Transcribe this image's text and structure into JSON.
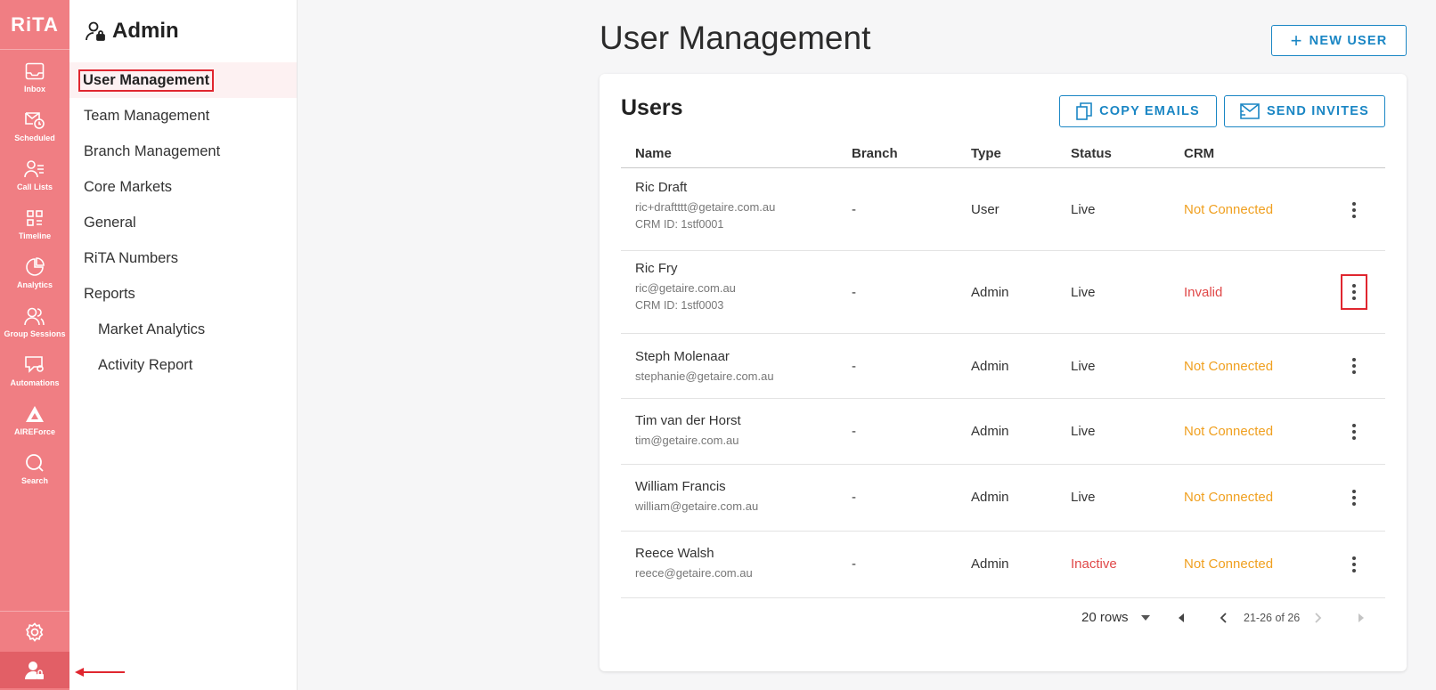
{
  "rail": {
    "logo": "RiTA",
    "items": [
      {
        "label": "Inbox",
        "icon": "inbox-icon"
      },
      {
        "label": "Scheduled",
        "icon": "scheduled-icon"
      },
      {
        "label": "Call Lists",
        "icon": "call-lists-icon"
      },
      {
        "label": "Timeline",
        "icon": "timeline-icon"
      },
      {
        "label": "Analytics",
        "icon": "analytics-icon"
      },
      {
        "label": "Group Sessions",
        "icon": "group-sessions-icon"
      },
      {
        "label": "Automations",
        "icon": "automations-icon"
      },
      {
        "label": "AIREForce",
        "icon": "aireforce-icon"
      },
      {
        "label": "Search",
        "icon": "search-icon"
      }
    ]
  },
  "sidebar": {
    "title": "Admin",
    "items": [
      {
        "label": "User Management",
        "active": true
      },
      {
        "label": "Team Management"
      },
      {
        "label": "Branch Management"
      },
      {
        "label": "Core Markets"
      },
      {
        "label": "General"
      },
      {
        "label": "RiTA Numbers"
      },
      {
        "label": "Reports"
      },
      {
        "label": "Market Analytics",
        "sub": true
      },
      {
        "label": "Activity Report",
        "sub": true
      }
    ]
  },
  "main": {
    "title": "User Management",
    "new_user_label": "NEW USER",
    "card_title": "Users",
    "copy_emails_label": "COPY EMAILS",
    "send_invites_label": "SEND INVITES",
    "columns": {
      "name": "Name",
      "branch": "Branch",
      "type": "Type",
      "status": "Status",
      "crm": "CRM"
    },
    "rows": [
      {
        "name": "Ric Draft",
        "email": "ric+draftttt@getaire.com.au",
        "crm_id": "CRM ID: 1stf0001",
        "branch": "-",
        "type": "User",
        "status": "Live",
        "crm": "Not Connected"
      },
      {
        "name": "Ric Fry",
        "email": "ric@getaire.com.au",
        "crm_id": "CRM ID: 1stf0003",
        "branch": "-",
        "type": "Admin",
        "status": "Live",
        "crm": "Invalid"
      },
      {
        "name": "Steph Molenaar",
        "email": "stephanie@getaire.com.au",
        "branch": "-",
        "type": "Admin",
        "status": "Live",
        "crm": "Not Connected"
      },
      {
        "name": "Tim van der Horst",
        "email": "tim@getaire.com.au",
        "branch": "-",
        "type": "Admin",
        "status": "Live",
        "crm": "Not Connected"
      },
      {
        "name": "William Francis",
        "email": "william@getaire.com.au",
        "branch": "-",
        "type": "Admin",
        "status": "Live",
        "crm": "Not Connected"
      },
      {
        "name": "Reece Walsh",
        "email": "reece@getaire.com.au",
        "branch": "-",
        "type": "Admin",
        "status": "Inactive",
        "crm": "Not Connected"
      }
    ],
    "pagination": {
      "rows_label": "20 rows",
      "range": "21-26 of 26"
    }
  },
  "colors": {
    "rail": "#f07e83",
    "accent": "#1a86c4",
    "warning": "#f0a020",
    "error": "#e04848"
  }
}
